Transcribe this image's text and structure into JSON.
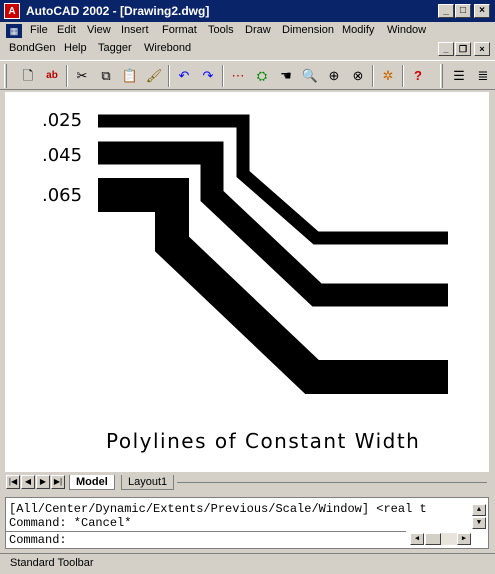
{
  "window": {
    "title": "AutoCAD 2002 - [Drawing2.dwg]",
    "minimize": "_",
    "maximize": "□",
    "close": "×"
  },
  "menu1": [
    "File",
    "Edit",
    "View",
    "Insert",
    "Format",
    "Tools",
    "Draw",
    "Dimension",
    "Modify",
    "Window"
  ],
  "menu2": [
    "BondGen",
    "Help",
    "Tagger",
    "Wirebond"
  ],
  "drawing": {
    "labels": [
      ".025",
      ".045",
      ".065"
    ],
    "caption": "Polylines of Constant Width"
  },
  "tabs": {
    "model": "Model",
    "layout1": "Layout1"
  },
  "command": {
    "line1": "[All/Center/Dynamic/Extents/Previous/Scale/Window] <real t",
    "line2": "Command: *Cancel*",
    "prompt": "Command:"
  },
  "status": "Standard Toolbar"
}
